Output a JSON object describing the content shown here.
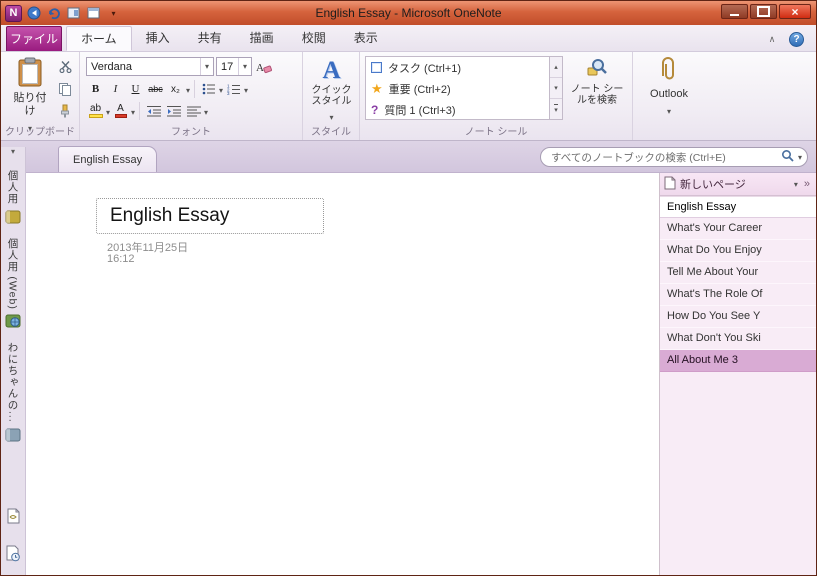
{
  "window": {
    "title": "English Essay - Microsoft OneNote",
    "app_icon_letter": "N"
  },
  "ribbon": {
    "file_tab": "ファイル",
    "tabs": [
      "ホーム",
      "挿入",
      "共有",
      "描画",
      "校閲",
      "表示"
    ],
    "clipboard": {
      "group_label": "クリップボード",
      "paste_label": "貼り付け"
    },
    "font": {
      "group_label": "フォント",
      "font_name": "Verdana",
      "font_size": "17",
      "bold": "B",
      "italic": "I",
      "underline": "U",
      "strike": "abc",
      "subscript": "x₂",
      "highlight": "ab",
      "font_color": "A"
    },
    "style": {
      "group_label": "スタイル",
      "quick_style_label": "クイックスタイル",
      "big_a": "A"
    },
    "tags": {
      "group_label": "ノート シール",
      "items": [
        {
          "label": "タスク (Ctrl+1)"
        },
        {
          "label": "重要 (Ctrl+2)"
        },
        {
          "label": "質問 1 (Ctrl+3)"
        }
      ],
      "find_label": "ノート シールを検索"
    },
    "outlook": {
      "button_label": "Outlook"
    }
  },
  "pagebar": {
    "section_tab": "English Essay",
    "search_placeholder": "すべてのノートブックの検索 (Ctrl+E)"
  },
  "notebooks": {
    "items": [
      "個人用",
      "個人用 (Web)",
      "わにちゃんの..."
    ]
  },
  "page": {
    "title": "English Essay",
    "date": "2013年11月25日",
    "time": "16:12"
  },
  "pages_panel": {
    "new_page_label": "新しいページ",
    "pages": [
      {
        "label": "English Essay",
        "state": "selected"
      },
      {
        "label": "What's Your Career",
        "state": "normal"
      },
      {
        "label": "What Do You Enjoy",
        "state": "normal"
      },
      {
        "label": "Tell Me About Your",
        "state": "normal"
      },
      {
        "label": "What's The Role Of",
        "state": "normal"
      },
      {
        "label": "How Do You See Y",
        "state": "normal"
      },
      {
        "label": "What Don't You Ski",
        "state": "normal"
      },
      {
        "label": "All About Me 3",
        "state": "highlighted"
      }
    ]
  },
  "colors": {
    "file_tab_purple": "#991b7f",
    "titlebar_red": "#c14d2a",
    "panel_pink": "#f8ecf6",
    "highlight_row": "#d9abd4"
  }
}
